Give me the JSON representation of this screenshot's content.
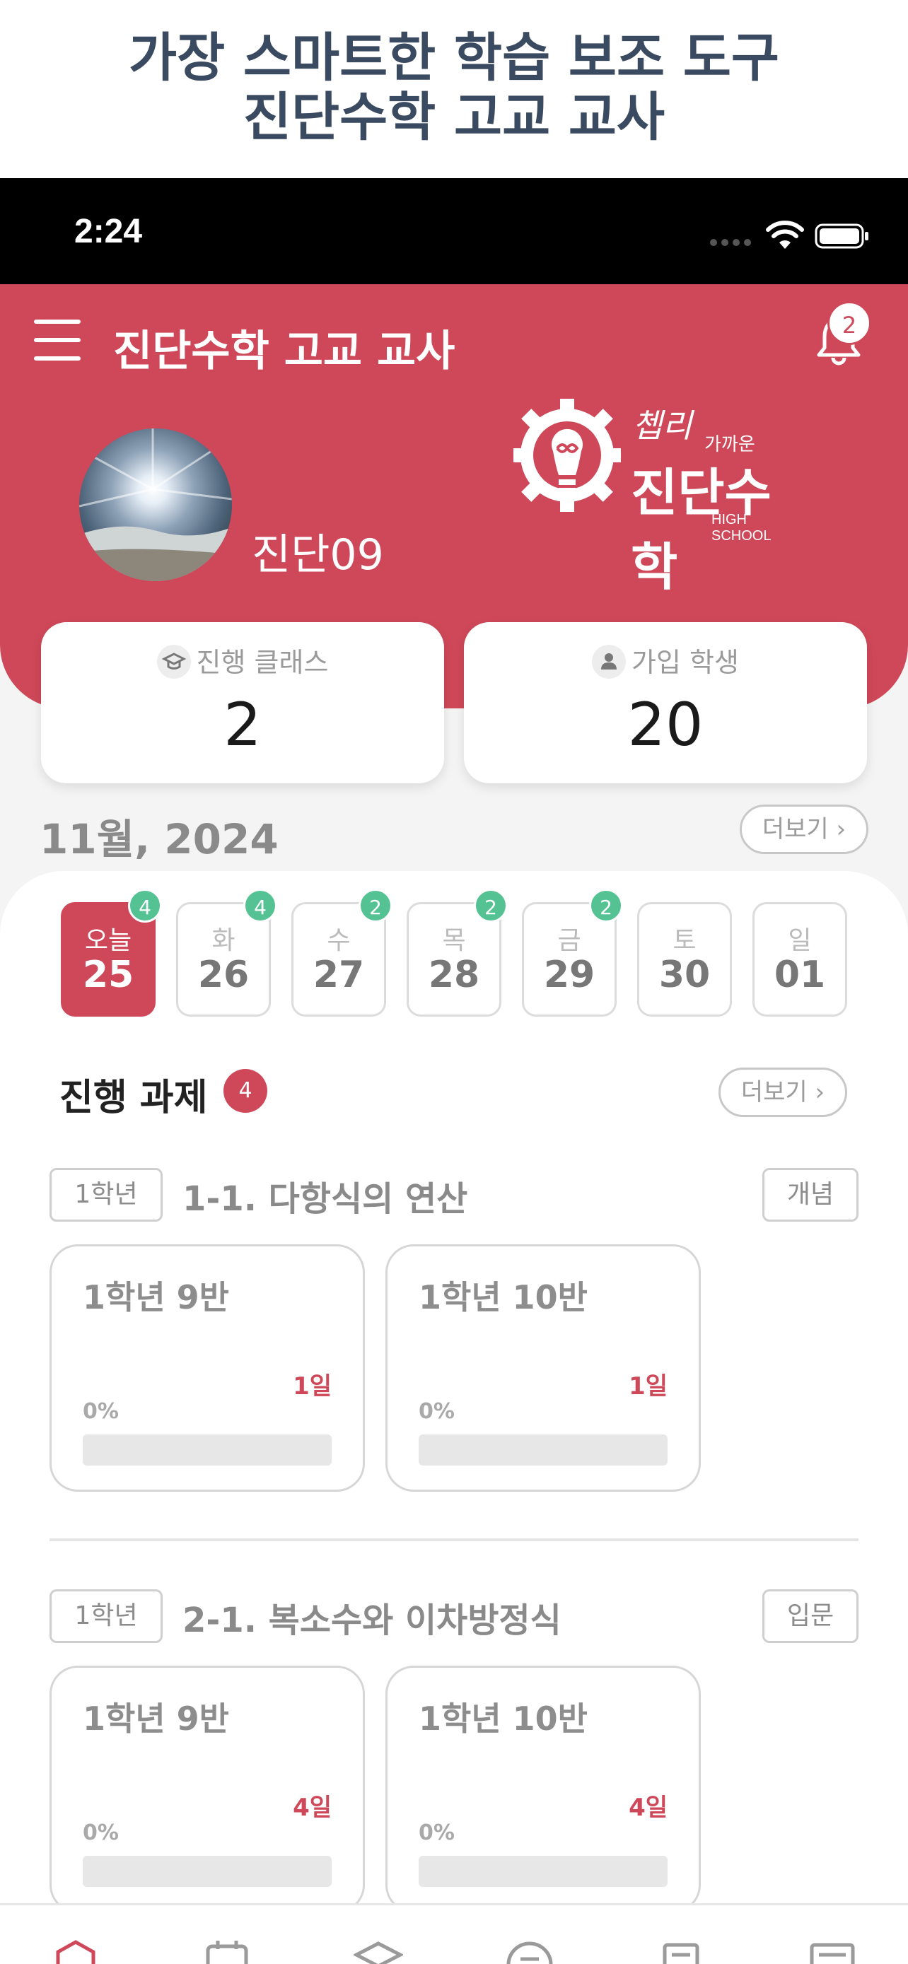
{
  "promo": {
    "line1": "가장 스마트한 학습 보조 도구",
    "line2": "진단수학 고교 교사"
  },
  "status_bar": {
    "time": "2:24"
  },
  "header": {
    "title": "진단수학 고교 교사",
    "notification_count": "2"
  },
  "profile": {
    "name": "진단09"
  },
  "logo": {
    "script": "쳅리",
    "small": "가까운",
    "brand": "진단수학",
    "sub": "HIGH SCHOOL"
  },
  "stats": [
    {
      "label": "진행 클래스",
      "icon": "graduation-cap-icon",
      "value": "2"
    },
    {
      "label": "가입 학생",
      "icon": "person-icon",
      "value": "20"
    }
  ],
  "calendar": {
    "month_label": "11월, 2024",
    "more_label": "더보기",
    "days": [
      {
        "dow": "오늘",
        "date": "25",
        "badge": "4",
        "active": true
      },
      {
        "dow": "화",
        "date": "26",
        "badge": "4",
        "active": false
      },
      {
        "dow": "수",
        "date": "27",
        "badge": "2",
        "active": false
      },
      {
        "dow": "목",
        "date": "28",
        "badge": "2",
        "active": false
      },
      {
        "dow": "금",
        "date": "29",
        "badge": "2",
        "active": false
      },
      {
        "dow": "토",
        "date": "30",
        "badge": "",
        "active": false
      },
      {
        "dow": "일",
        "date": "01",
        "badge": "",
        "active": false
      }
    ]
  },
  "assignments": {
    "title": "진행 과제",
    "count": "4",
    "more_label": "더보기",
    "units": [
      {
        "grade": "1학년",
        "title": "1-1. 다항식의 연산",
        "level": "개념",
        "classes": [
          {
            "name": "1학년 9반",
            "days_left": "1일",
            "progress_label": "0%",
            "progress": 0
          },
          {
            "name": "1학년 10반",
            "days_left": "1일",
            "progress_label": "0%",
            "progress": 0
          }
        ]
      },
      {
        "grade": "1학년",
        "title": "2-1. 복소수와 이차방정식",
        "level": "입문",
        "classes": [
          {
            "name": "1학년 9반",
            "days_left": "4일",
            "progress_label": "0%",
            "progress": 0
          },
          {
            "name": "1학년 10반",
            "days_left": "4일",
            "progress_label": "0%",
            "progress": 0
          }
        ]
      }
    ]
  },
  "tabbar": {
    "items": [
      "home-icon",
      "calendar-icon",
      "class-icon",
      "chat-icon",
      "assignment-icon",
      "report-icon"
    ]
  },
  "colors": {
    "brand": "#cf4859",
    "badge_green": "#55c294"
  }
}
